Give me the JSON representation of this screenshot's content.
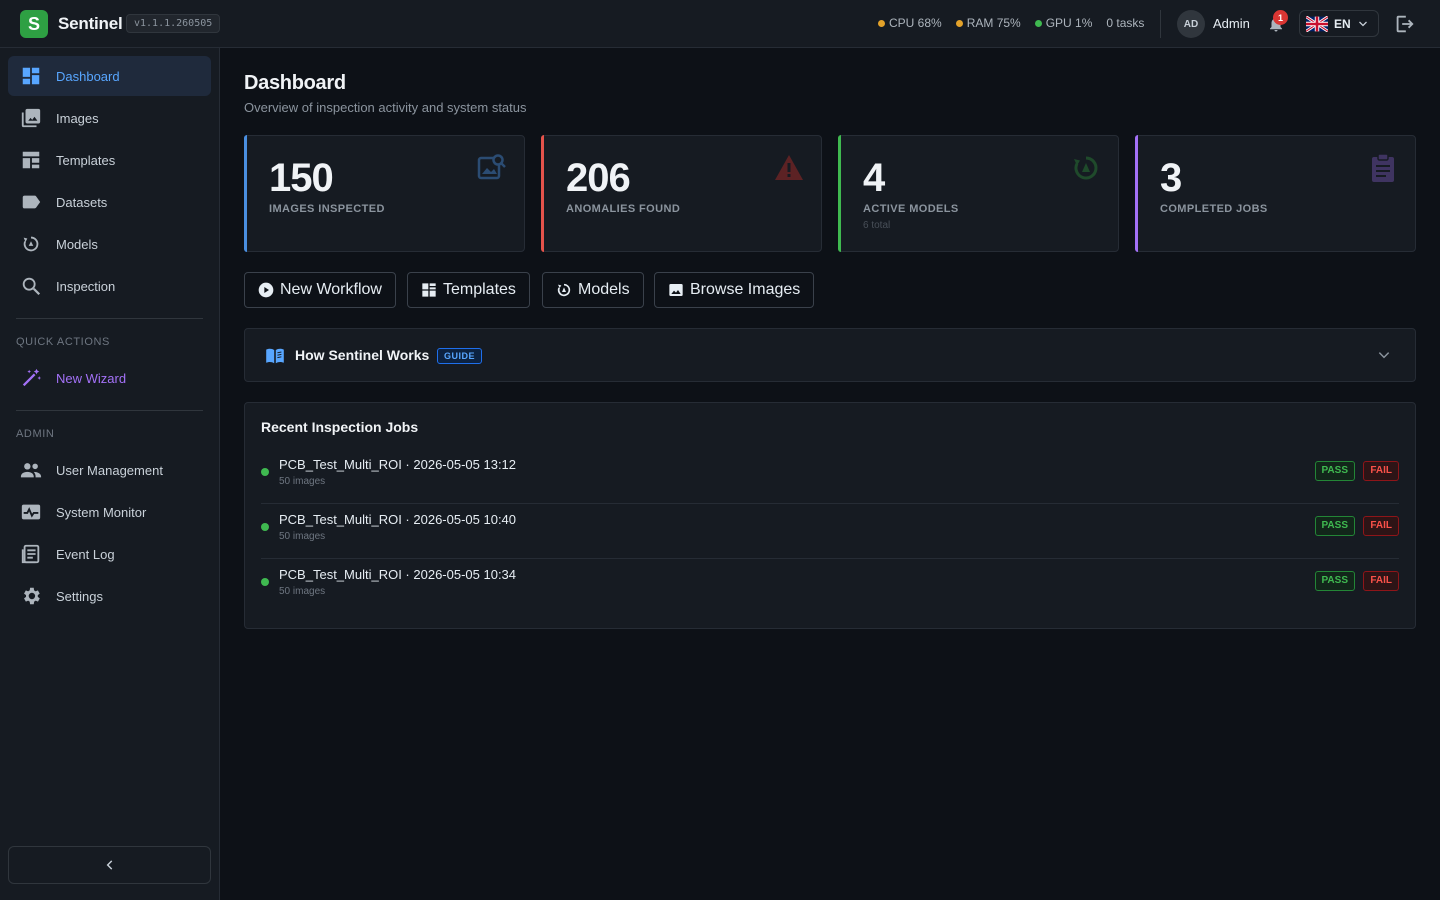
{
  "app": {
    "logo_letter": "S",
    "name": "Sentinel",
    "version": "v1.1.1.260505"
  },
  "system": {
    "cpu": "CPU 68%",
    "ram": "RAM 75%",
    "gpu": "GPU 1%",
    "tasks": "0 tasks",
    "colors": {
      "cpu": "#e3a22a",
      "ram": "#e3a22a",
      "gpu": "#3fb950"
    }
  },
  "user": {
    "initials": "AD",
    "name": "Admin",
    "notifications": "1",
    "language": "EN"
  },
  "sidebar": {
    "items": [
      {
        "label": "Dashboard",
        "icon": "dashboard-icon"
      },
      {
        "label": "Images",
        "icon": "images-icon"
      },
      {
        "label": "Templates",
        "icon": "templates-icon"
      },
      {
        "label": "Datasets",
        "icon": "datasets-icon"
      },
      {
        "label": "Models",
        "icon": "models-icon"
      },
      {
        "label": "Inspection",
        "icon": "search-icon"
      }
    ],
    "quick_actions_label": "QUICK ACTIONS",
    "quick_actions": [
      {
        "label": "New Wizard",
        "icon": "magic-wand-icon"
      }
    ],
    "admin_label": "ADMIN",
    "admin_items": [
      {
        "label": "User Management",
        "icon": "users-icon"
      },
      {
        "label": "System Monitor",
        "icon": "monitor-icon"
      },
      {
        "label": "Event Log",
        "icon": "event-log-icon"
      },
      {
        "label": "Settings",
        "icon": "gear-icon"
      }
    ]
  },
  "page": {
    "title": "Dashboard",
    "subtitle": "Overview of inspection activity and system status"
  },
  "stats": [
    {
      "value": "150",
      "label": "IMAGES INSPECTED",
      "sub": "",
      "color": "#4a8fe0",
      "icon": "image-search-icon"
    },
    {
      "value": "206",
      "label": "ANOMALIES FOUND",
      "sub": "",
      "color": "#e5534b",
      "icon": "warning-icon"
    },
    {
      "value": "4",
      "label": "ACTIVE MODELS",
      "sub": "6 total",
      "color": "#3fb950",
      "icon": "model-sync-icon"
    },
    {
      "value": "3",
      "label": "COMPLETED JOBS",
      "sub": "",
      "color": "#a371f7",
      "icon": "clipboard-icon"
    }
  ],
  "quick_buttons": [
    {
      "label": "New Workflow",
      "icon": "play-circle-icon"
    },
    {
      "label": "Templates",
      "icon": "templates-icon"
    },
    {
      "label": "Models",
      "icon": "models-icon"
    },
    {
      "label": "Browse Images",
      "icon": "images-icon"
    }
  ],
  "guide": {
    "title": "How Sentinel Works",
    "badge": "GUIDE"
  },
  "jobs": {
    "title": "Recent Inspection Jobs",
    "rows": [
      {
        "name": "PCB_Test_Multi_ROI · 2026-05-05 13:12",
        "meta": "50 images",
        "pass": "PASS",
        "fail": "FAIL"
      },
      {
        "name": "PCB_Test_Multi_ROI · 2026-05-05 10:40",
        "meta": "50 images",
        "pass": "PASS",
        "fail": "FAIL"
      },
      {
        "name": "PCB_Test_Multi_ROI · 2026-05-05 10:34",
        "meta": "50 images",
        "pass": "PASS",
        "fail": "FAIL"
      }
    ]
  }
}
